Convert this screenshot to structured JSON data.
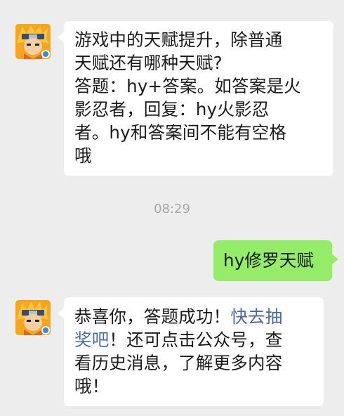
{
  "messages": [
    {
      "sender": "official-account",
      "lines": [
        "游戏中的天赋提升，除普通",
        "天赋还有哪种天赋?",
        "答题：hy+答案。如答案是火",
        "影忍者，回复：hy火影忍",
        "者。hy和答案间不能有空格",
        "哦"
      ]
    },
    {
      "sender": "user",
      "text": "hy修罗天赋"
    },
    {
      "sender": "official-account",
      "line1_text": "恭喜你，答题成功！",
      "line1_link": "快去抽",
      "line2_link": "奖吧",
      "line2_text": "！还可点击公众号，查",
      "line3": "看历史消息，了解更多内容",
      "line4": "哦！"
    }
  ],
  "timestamp": "08:29",
  "colors": {
    "background": "#ededed",
    "incoming_bubble": "#ffffff",
    "outgoing_bubble": "#95ec69",
    "link": "#4b6aa6"
  },
  "icons": {
    "avatar": "naruto-game-avatar-icon"
  }
}
